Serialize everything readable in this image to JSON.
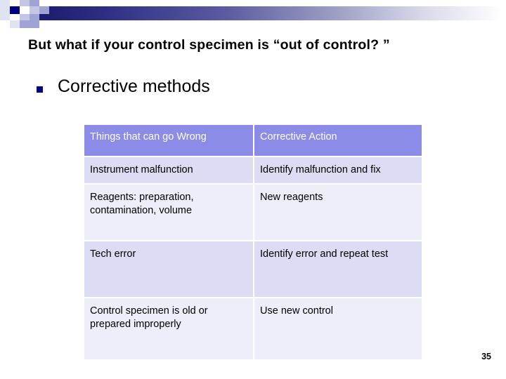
{
  "slide": {
    "title": "But what if your control specimen is “out of control? ”",
    "bullet": {
      "marker": "square-bullet",
      "text": "Corrective methods"
    },
    "page_number": "35"
  },
  "theme": {
    "band_dark": "#1c1d6e",
    "band_light": "#ffffff",
    "bullet_color": "#000080",
    "table_header_bg": "#8a8ce8",
    "table_header_text": "#ffffff",
    "row_dark_bg": "#dcdcf5",
    "row_light_bg": "#eeeefa",
    "cell_text": "#000000"
  },
  "table": {
    "columns": [
      "Things that can go Wrong",
      "Corrective Action"
    ],
    "rows": [
      {
        "problem": "Instrument malfunction",
        "action": "Identify malfunction and fix"
      },
      {
        "problem": "Reagents: preparation, contamination, volume",
        "action": "New reagents"
      },
      {
        "problem": "Tech error",
        "action": "Identify error and repeat test"
      },
      {
        "problem": "Control specimen is old or prepared improperly",
        "action": "Use new control"
      }
    ]
  }
}
